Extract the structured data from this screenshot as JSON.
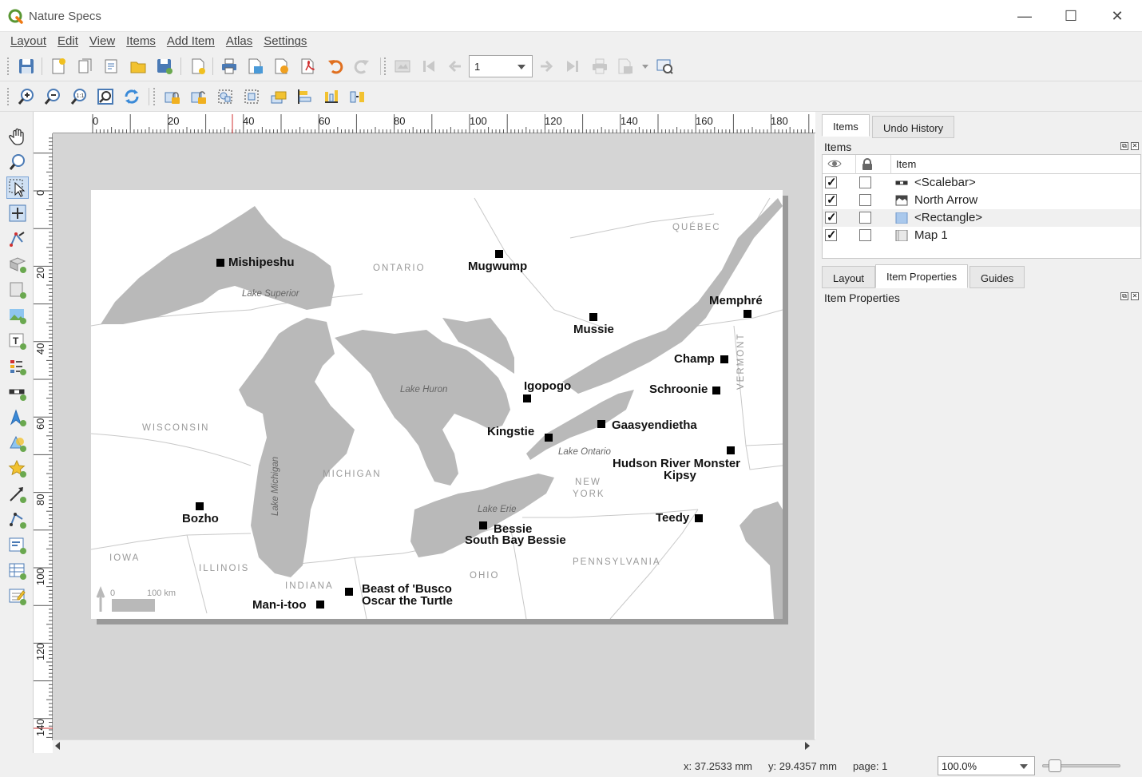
{
  "window": {
    "title": "Nature Specs",
    "minimize_glyph": "—",
    "maximize_glyph": "☐",
    "close_glyph": "✕"
  },
  "menu": [
    "Layout",
    "Edit",
    "View",
    "Items",
    "Add Item",
    "Atlas",
    "Settings"
  ],
  "toolbar": {
    "page_value": "1"
  },
  "ruler": {
    "h_ticks": [
      "0",
      "20",
      "40",
      "60",
      "80",
      "100",
      "120",
      "140",
      "160",
      "180"
    ],
    "v_ticks": [
      "0",
      "20",
      "40",
      "60",
      "80",
      "100",
      "120",
      "140"
    ]
  },
  "map": {
    "markers": [
      {
        "name": "Mishipeshu"
      },
      {
        "name": "Mugwump"
      },
      {
        "name": "Memphré"
      },
      {
        "name": "Mussie"
      },
      {
        "name": "Champ"
      },
      {
        "name": "Igopogo"
      },
      {
        "name": "Schroonie"
      },
      {
        "name": "Gaasyendietha"
      },
      {
        "name": "Kingstie"
      },
      {
        "name": "Hudson River Monster"
      },
      {
        "name": "Kipsy"
      },
      {
        "name": "Bozho"
      },
      {
        "name": "Teedy"
      },
      {
        "name": "Bessie"
      },
      {
        "name": "South Bay Bessie"
      },
      {
        "name": "Beast of 'Busco"
      },
      {
        "name": "Oscar the Turtle"
      },
      {
        "name": "Man-i-too"
      }
    ],
    "regions": [
      "ONTARIO",
      "QUÉBEC",
      "WISCONSIN",
      "MICHIGAN",
      "IOWA",
      "ILLINOIS",
      "INDIANA",
      "OHIO",
      "NEW",
      "YORK",
      "PENNSYLVANIA",
      "VERMONT"
    ],
    "lakes": [
      "Lake Superior",
      "Lake Huron",
      "Lake Michigan",
      "Lake Ontario",
      "Lake Erie"
    ],
    "scalebar": {
      "start": "0",
      "end": "100 km"
    }
  },
  "panel": {
    "top_tabs": [
      "Items",
      "Undo History"
    ],
    "items_title": "Items",
    "columns": {
      "item": "Item"
    },
    "items": [
      {
        "label": "<Scalebar>",
        "visible": true,
        "locked": false,
        "icon": "scalebar-icon"
      },
      {
        "label": "North Arrow",
        "visible": true,
        "locked": false,
        "icon": "picture-icon"
      },
      {
        "label": "<Rectangle>",
        "visible": true,
        "locked": false,
        "icon": "rectangle-icon"
      },
      {
        "label": "Map 1",
        "visible": true,
        "locked": false,
        "icon": "map-icon"
      }
    ],
    "bottom_tabs": [
      "Layout",
      "Item Properties",
      "Guides"
    ],
    "properties_title": "Item Properties"
  },
  "status": {
    "x": "x: 37.2533 mm",
    "y": "y: 29.4357 mm",
    "page": "page: 1",
    "zoom": "100.0%"
  },
  "colors": {
    "land": "#ffffff",
    "water": "#b9b9b9",
    "border": "#c8c8c8",
    "pasteboard": "#d5d5d5"
  }
}
